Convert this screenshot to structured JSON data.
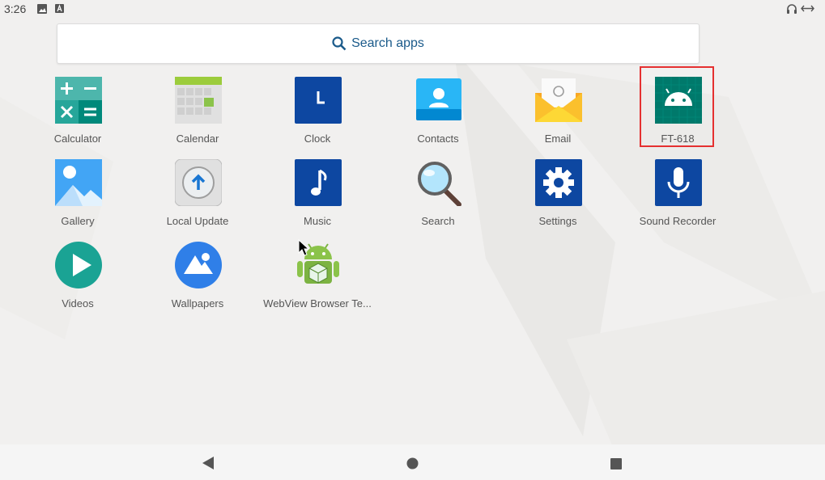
{
  "status_bar": {
    "time": "3:26"
  },
  "search": {
    "label": "Search apps"
  },
  "apps": [
    {
      "label": "Calculator",
      "icon": "calculator-icon"
    },
    {
      "label": "Calendar",
      "icon": "calendar-icon"
    },
    {
      "label": "Clock",
      "icon": "clock-icon"
    },
    {
      "label": "Contacts",
      "icon": "contacts-icon"
    },
    {
      "label": "Email",
      "icon": "email-icon"
    },
    {
      "label": "FT-618",
      "icon": "android-icon"
    },
    {
      "label": "Gallery",
      "icon": "gallery-icon"
    },
    {
      "label": "Local Update",
      "icon": "local-update-icon"
    },
    {
      "label": "Music",
      "icon": "music-icon"
    },
    {
      "label": "Search",
      "icon": "magnifier-icon"
    },
    {
      "label": "Settings",
      "icon": "gear-icon"
    },
    {
      "label": "Sound Recorder",
      "icon": "microphone-icon"
    },
    {
      "label": "Videos",
      "icon": "play-icon"
    },
    {
      "label": "Wallpapers",
      "icon": "wallpaper-icon"
    },
    {
      "label": "WebView Browser Te...",
      "icon": "android-box-icon"
    }
  ],
  "nav": {
    "back": "back-icon",
    "home": "home-icon",
    "recents": "recents-icon"
  }
}
